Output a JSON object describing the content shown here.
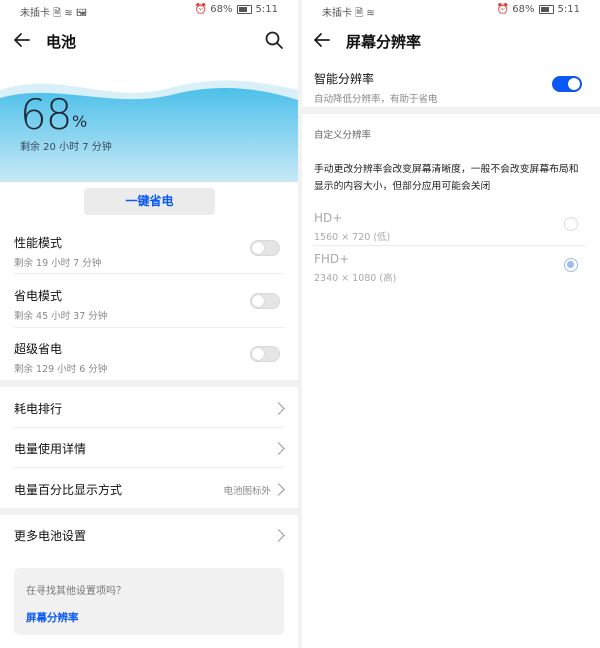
{
  "colors": {
    "accent": "#0a59f7",
    "wave_top": "#5ec6ec",
    "wave_bottom": "#bfe4f3"
  },
  "left": {
    "status": {
      "carrier": "未插卡 🗎 ≋ 🖼",
      "right": "⏰ 68%",
      "time": "5:11"
    },
    "header": {
      "title": "电池",
      "search_icon": "search-icon"
    },
    "battery": {
      "percent": "68",
      "unit": "%",
      "remaining": "剩余 20 小时 7 分钟"
    },
    "one_key_button": "一键省电",
    "modes": [
      {
        "title": "性能模式",
        "subtitle": "剩余 19 小时 7 分钟",
        "on": false
      },
      {
        "title": "省电模式",
        "subtitle": "剩余 45 小时 37 分钟",
        "on": false
      },
      {
        "title": "超级省电",
        "subtitle": "剩余 129 小时 6 分钟",
        "on": false
      }
    ],
    "menu": [
      {
        "title": "耗电排行",
        "value": ""
      },
      {
        "title": "电量使用详情",
        "value": ""
      },
      {
        "title": "电量百分比显示方式",
        "value": "电池图标外"
      }
    ],
    "more": "更多电池设置",
    "suggest": {
      "question": "在寻找其他设置项吗？",
      "link": "屏幕分辨率"
    }
  },
  "right": {
    "status": {
      "carrier": "未插卡 🗎 ≋",
      "right": "⏰ 68%",
      "time": "5:11"
    },
    "header": {
      "title": "屏幕分辨率"
    },
    "smart": {
      "title": "智能分辨率",
      "subtitle": "自动降低分辨率，有助于省电",
      "on": true
    },
    "custom_label": "自定义分辨率",
    "description": "手动更改分辨率会改变屏幕清晰度，一般不会改变屏幕布局和显示的内容大小，但部分应用可能会关闭",
    "options": [
      {
        "name": "HD+",
        "detail": "1560 × 720 (低)",
        "selected": false
      },
      {
        "name": "FHD+",
        "detail": "2340 × 1080 (高)",
        "selected": true
      }
    ]
  }
}
